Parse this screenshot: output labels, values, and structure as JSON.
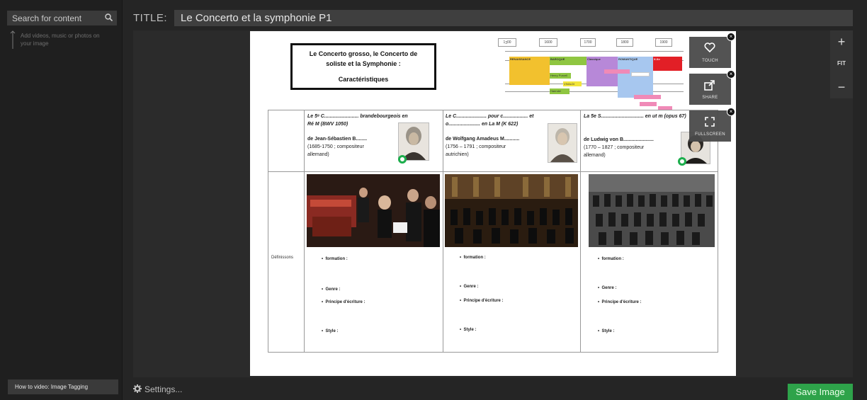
{
  "sidebar": {
    "search_placeholder": "Search for content",
    "hint": "Add videos, music or photos on your image",
    "howto": "How to video: Image Tagging"
  },
  "header": {
    "title_label": "TITLE:",
    "title_value": "Le Concerto et la symphonie P1"
  },
  "overlay": {
    "touch": "TOUCH",
    "share": "SHARE",
    "fullscreen": "FULLSCREEN"
  },
  "zoom": {
    "plus": "+",
    "fit": "FIT",
    "minus": "−"
  },
  "footer": {
    "settings": "Settings...",
    "save": "Save Image"
  },
  "document": {
    "title_l1": "Le Concerto grosso,  le Concerto de",
    "title_l2": "soliste et la Symphonie :",
    "title_l3": "Caractéristiques",
    "timeline": {
      "years": [
        "1600",
        "1700",
        "1800",
        "1900"
      ],
      "first_year": "1ʒ00",
      "eras": [
        "RENAISSANCE",
        "BAROQUE",
        "Classique",
        "ROMANTIQUE",
        "X.Xe"
      ],
      "baroque_names": [
        "Henry Purcell",
        "VIVALDI",
        "Haendel"
      ],
      "other_names": [
        "Haydn"
      ]
    },
    "col1": {
      "l1": "Le 5ᵉ C......................... brandebourgeois en",
      "l2": "Ré M (BWV 1050)",
      "l3": "de Jean-Sébastien B........",
      "l4": "(1685-1750 ; compositeur",
      "l5": "allemand)"
    },
    "col2": {
      "l1": "Le C...................... pour c.................. et",
      "l2": "o....................... en La M (K 622)",
      "l3": "de Wolfgang Amadeus M...........",
      "l4": "(1756 – 1791 ; compositeur",
      "l5": "autrichien)"
    },
    "col3": {
      "l1": "La 5e  S............................... en ut m (opus 67)",
      "l3": "de Ludwig von B......................",
      "l4": "(1770 – 1827 ; compositeur",
      "l5": "allemand)"
    },
    "definitions_label": "Définissons",
    "bullets": [
      "formation :",
      "Genre :",
      "Principe d'écriture :",
      "Style :"
    ]
  },
  "colors": {
    "accent_green": "#2ea34a",
    "ring_green": "#1cae4c",
    "renaissance": "#f2c12e",
    "baroque": "#8fc641",
    "classique": "#b788d8",
    "romantique": "#a7c7ef",
    "xxe": "#e21f26"
  }
}
